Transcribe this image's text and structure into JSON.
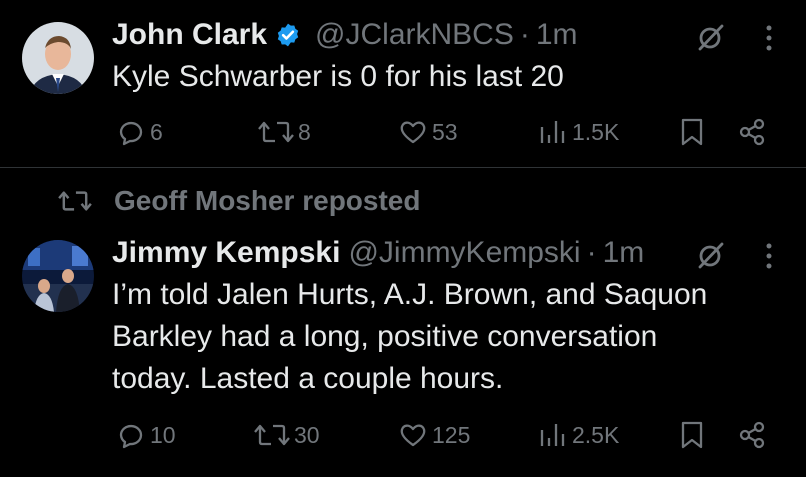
{
  "tweet1": {
    "author_name": "John Clark",
    "handle": "@JClarkNBCS",
    "separator": "·",
    "time": "1m",
    "text": "Kyle Schwarber is 0 for his last 20",
    "replies": "6",
    "reposts": "8",
    "likes": "53",
    "views": "1.5K"
  },
  "tweet2": {
    "repost_label": "Geoff Mosher reposted",
    "author_name": "Jimmy Kempski",
    "handle": "@JimmyKempski",
    "separator": "·",
    "time": "1m",
    "text_lines": [
      "I’m told Jalen Hurts, A.J. Brown, and Saquon",
      "Barkley had a long, positive conversation",
      "today. Lasted a couple hours."
    ],
    "replies": "10",
    "reposts": "30",
    "likes": "125",
    "views": "2.5K"
  },
  "colors": {
    "background": "#000000",
    "text": "#e7e9ea",
    "muted": "#71767b",
    "verified": "#1d9bf0",
    "divider": "#2f3336"
  }
}
